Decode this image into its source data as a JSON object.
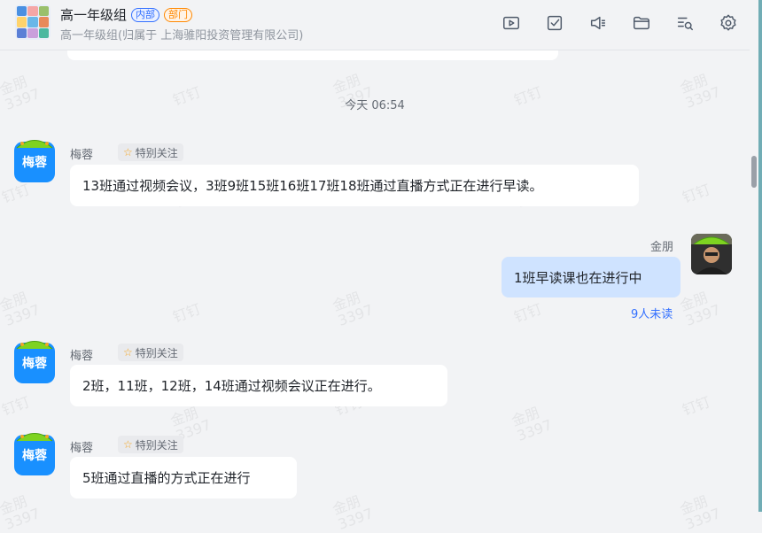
{
  "header": {
    "title": "高一年级组",
    "tags": [
      "内部",
      "部门"
    ],
    "subtitle": "高一年级组(归属于 上海骓阳投资管理有限公司)",
    "toolbar": [
      {
        "icon": "live-icon"
      },
      {
        "icon": "todo-check-icon"
      },
      {
        "icon": "announcement-icon"
      },
      {
        "icon": "folder-icon"
      },
      {
        "icon": "search-history-icon"
      },
      {
        "icon": "settings-gear-icon"
      }
    ]
  },
  "timestamp": "今天 06:54",
  "messages": [
    {
      "sender": "梅蓉",
      "avatar_text": "梅蓉",
      "badge": "特别关注",
      "text": "13班通过视频会议，3班9班15班16班17班18班通过直播方式正在进行早读。"
    },
    {
      "sender": "金朋",
      "text": "1班早读课也在进行中",
      "status": "9人未读"
    },
    {
      "sender": "梅蓉",
      "avatar_text": "梅蓉",
      "badge": "特别关注",
      "text": "2班，11班，12班，14班通过视频会议正在进行。"
    },
    {
      "sender": "梅蓉",
      "avatar_text": "梅蓉",
      "badge": "特别关注",
      "text": "5班通过直播的方式正在进行"
    }
  ],
  "watermark": {
    "name": "金朋",
    "number": "3397",
    "app": "钉钉"
  },
  "colors": {
    "accent": "#3370ff",
    "avatar_blue": "#1990ff",
    "my_bubble": "#cfe3ff",
    "orange_tag": "#ff8800"
  }
}
